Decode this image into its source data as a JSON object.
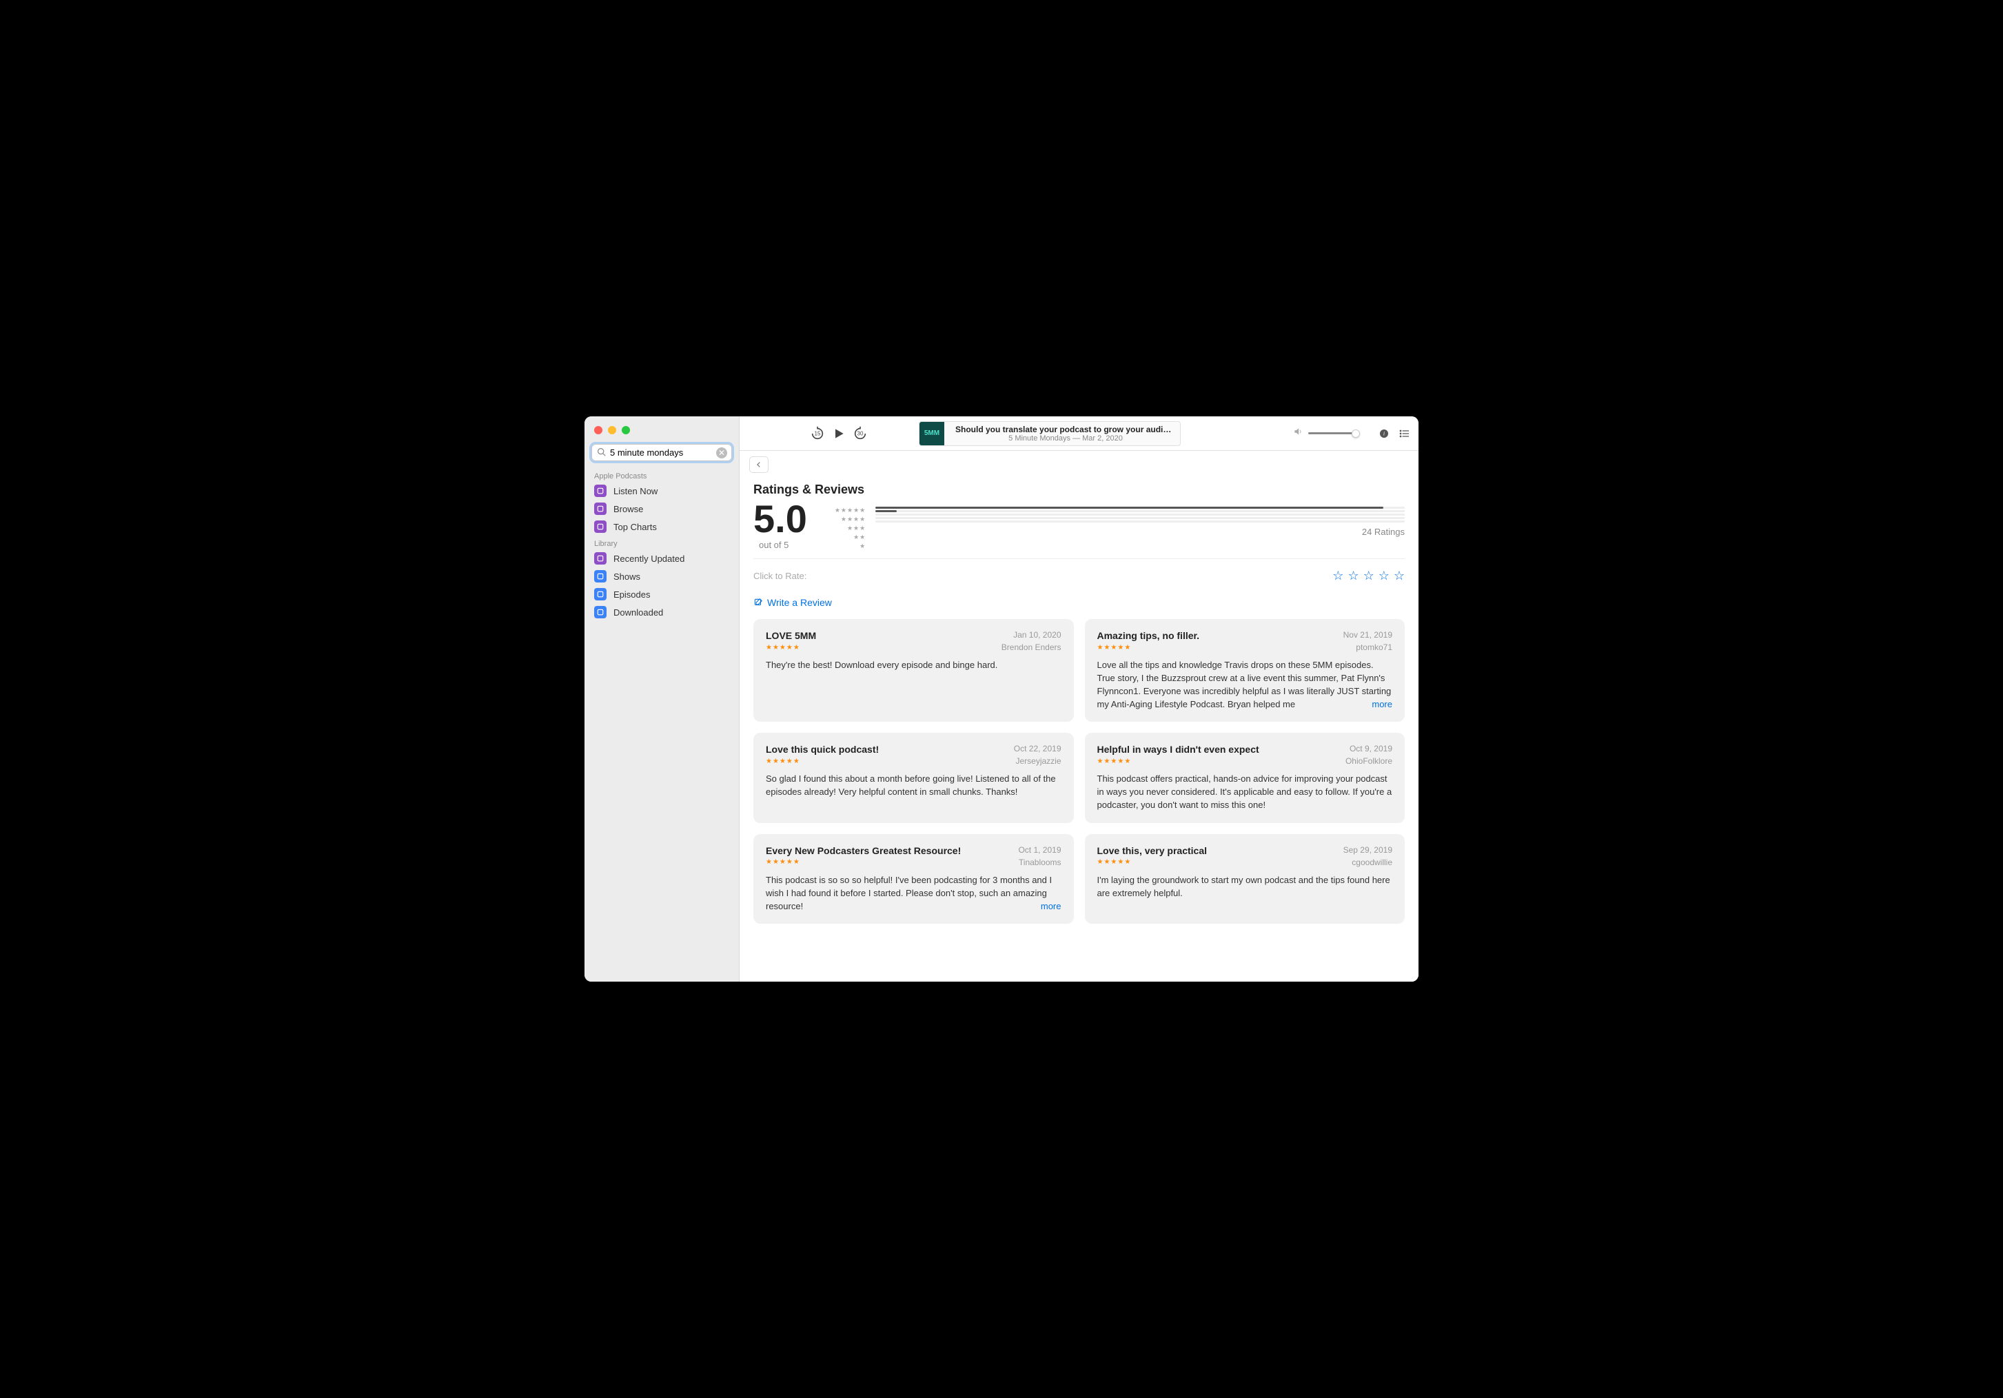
{
  "search": {
    "value": "5 minute mondays"
  },
  "sidebar": {
    "sections": [
      {
        "label": "Apple Podcasts",
        "items": [
          {
            "label": "Listen Now",
            "icon": "play-circle",
            "color": "purple"
          },
          {
            "label": "Browse",
            "icon": "grid",
            "color": "purple"
          },
          {
            "label": "Top Charts",
            "icon": "list",
            "color": "purple"
          }
        ]
      },
      {
        "label": "Library",
        "items": [
          {
            "label": "Recently Updated",
            "icon": "clock",
            "color": "purple"
          },
          {
            "label": "Shows",
            "icon": "stack",
            "color": "blue"
          },
          {
            "label": "Episodes",
            "icon": "lines",
            "color": "blue"
          },
          {
            "label": "Downloaded",
            "icon": "download",
            "color": "blue"
          }
        ]
      }
    ]
  },
  "nowplaying": {
    "art_text": "5MM",
    "title": "Should you translate your podcast to grow your audience?",
    "subtitle": "5 Minute Mondays — Mar 2, 2020"
  },
  "skip": {
    "back": "15",
    "forward": "30"
  },
  "ratings": {
    "heading": "Ratings & Reviews",
    "score": "5.0",
    "out_of": "out of 5",
    "count": "24 Ratings",
    "breakdown_pct": [
      96,
      4,
      0,
      0,
      0
    ],
    "rate_label": "Click to Rate:",
    "write_label": "Write a Review"
  },
  "reviews": [
    {
      "title": "LOVE 5MM",
      "date": "Jan 10, 2020",
      "author": "Brendon Enders",
      "body": "They're the best! Download every episode and binge hard.",
      "has_more": false
    },
    {
      "title": "Amazing tips, no filler.",
      "date": "Nov 21, 2019",
      "author": "ptomko71",
      "body": "Love all the tips and knowledge Travis drops on these 5MM episodes. True story, I the Buzzsprout crew at a live event this summer, Pat Flynn's Flynncon1. Everyone was incredibly helpful as I was literally JUST starting my Anti-Aging Lifestyle Podcast. Bryan helped me",
      "has_more": true,
      "more_label": "more"
    },
    {
      "title": "Love this quick podcast!",
      "date": "Oct 22, 2019",
      "author": "Jerseyjazzie",
      "body": "So glad I found this about a month before going live!  Listened to all of the episodes already!  Very helpful content in small chunks. Thanks!",
      "has_more": false
    },
    {
      "title": "Helpful in ways I didn't even expect",
      "date": "Oct 9, 2019",
      "author": "OhioFolklore",
      "body": "This podcast offers practical, hands-on advice for improving your podcast in ways you never considered. It's applicable and easy to follow. If you're a podcaster, you don't want to miss this one!",
      "has_more": false
    },
    {
      "title": "Every New Podcasters Greatest Resource!",
      "date": "Oct 1, 2019",
      "author": "Tinablooms",
      "body": "This podcast is so so so helpful! I've been podcasting for 3 months and I wish I had found it before I started. Please don't stop, such an amazing resource!",
      "has_more": true,
      "more_label": "more"
    },
    {
      "title": "Love this, very practical",
      "date": "Sep 29, 2019",
      "author": "cgoodwillie",
      "body": "I'm laying the groundwork to start my own podcast and the tips found here are extremely helpful.",
      "has_more": false
    }
  ]
}
